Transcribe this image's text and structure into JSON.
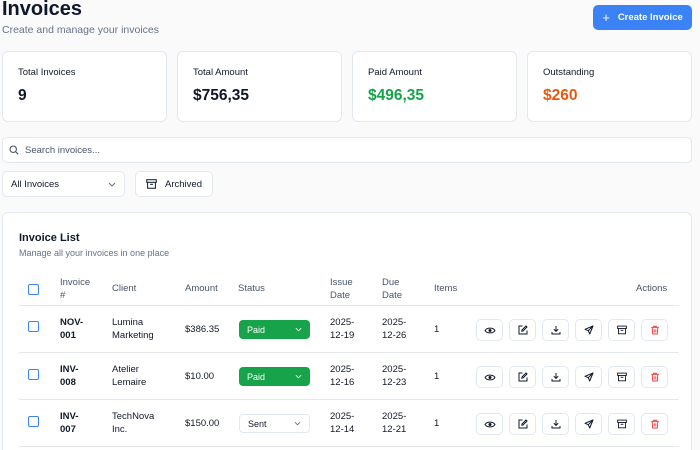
{
  "header": {
    "title": "Invoices",
    "subtitle": "Create and manage your invoices",
    "create_label": "Create Invoice"
  },
  "stats": [
    {
      "label": "Total Invoices",
      "value": "9",
      "color": "#0f172a"
    },
    {
      "label": "Total Amount",
      "value": "$756,35",
      "color": "#0f172a"
    },
    {
      "label": "Paid Amount",
      "value": "$496,35",
      "color": "#16a34a"
    },
    {
      "label": "Outstanding",
      "value": "$260",
      "color": "#ea580c"
    }
  ],
  "search": {
    "placeholder": "Search invoices..."
  },
  "filter": {
    "selected": "All Invoices",
    "archived_label": "Archived"
  },
  "list": {
    "title": "Invoice List",
    "subtitle": "Manage all your invoices in one place",
    "columns": {
      "invoice_1": "Invoice",
      "invoice_2": "#",
      "client": "Client",
      "amount": "Amount",
      "status": "Status",
      "issue_1": "Issue",
      "issue_2": "Date",
      "due_1": "Due",
      "due_2": "Date",
      "items": "Items",
      "actions": "Actions"
    },
    "rows": [
      {
        "id_1": "NOV-",
        "id_2": "001",
        "client_1": "Lumina",
        "client_2": "Marketing",
        "amount": "$386.35",
        "status": "Paid",
        "issue_1": "2025-",
        "issue_2": "12-19",
        "due_1": "2025-",
        "due_2": "12-26",
        "items": "1"
      },
      {
        "id_1": "INV-",
        "id_2": "008",
        "client_1": "Atelier",
        "client_2": "Lemaire",
        "amount": "$10.00",
        "status": "Paid",
        "issue_1": "2025-",
        "issue_2": "12-16",
        "due_1": "2025-",
        "due_2": "12-23",
        "items": "1"
      },
      {
        "id_1": "INV-",
        "id_2": "007",
        "client_1": "TechNova",
        "client_2": "Inc.",
        "amount": "$150.00",
        "status": "Sent",
        "issue_1": "2025-",
        "issue_2": "12-14",
        "due_1": "2025-",
        "due_2": "12-21",
        "items": "1"
      }
    ]
  },
  "icons": {
    "plus": "plus-icon",
    "search": "search-icon",
    "chevron": "chevron-down-icon",
    "archive": "archive-icon",
    "view": "eye-icon",
    "edit": "edit-icon",
    "download": "download-icon",
    "send": "send-icon",
    "delete": "trash-icon"
  },
  "colors": {
    "accent": "#3b82f6",
    "paid": "#16a34a",
    "outstanding": "#ea580c",
    "danger": "#ef4444"
  }
}
